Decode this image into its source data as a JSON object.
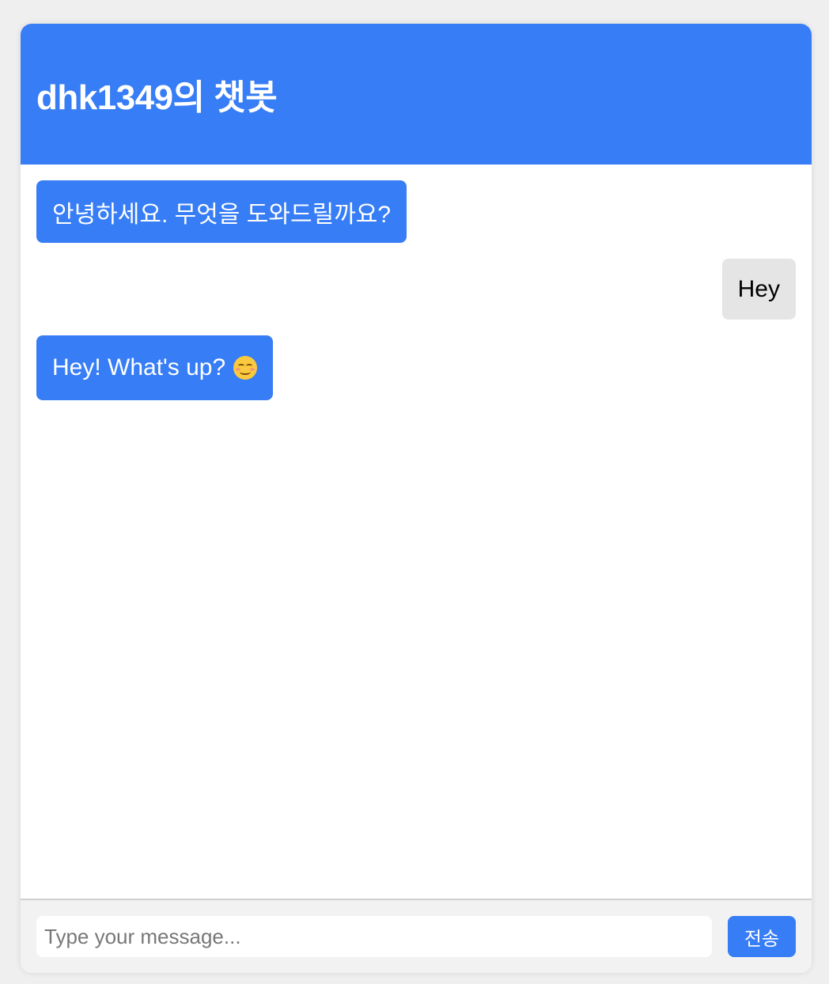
{
  "header": {
    "title": "dhk1349의 챗봇",
    "color": "#377df6"
  },
  "messages": [
    {
      "sender": "bot",
      "text": "안녕하세요. 무엇을 도와드릴까요?"
    },
    {
      "sender": "user",
      "text": "Hey"
    },
    {
      "sender": "bot",
      "text": "Hey! What's up?",
      "emoji": "smiling-face-icon"
    }
  ],
  "input": {
    "placeholder": "Type your message...",
    "value": ""
  },
  "send_button": {
    "label": "전송"
  },
  "colors": {
    "bot_bubble": "#377df6",
    "user_bubble": "#e5e5e5",
    "background": "#efefef"
  }
}
